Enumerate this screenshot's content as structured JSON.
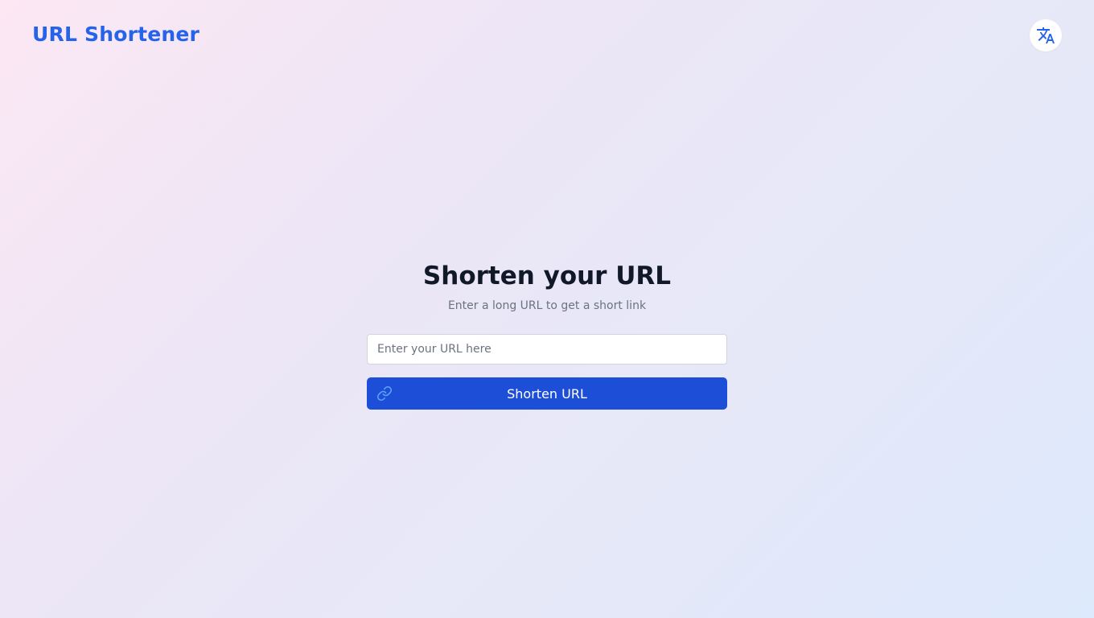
{
  "header": {
    "brand": "URL Shortener",
    "language_icon": "translate-icon"
  },
  "main": {
    "title": "Shorten your URL",
    "subtitle": "Enter a long URL to get a short link",
    "url_input": {
      "value": "",
      "placeholder": "Enter your URL here"
    },
    "shorten_button": {
      "label": "Shorten URL",
      "icon": "link-icon"
    }
  },
  "colors": {
    "brand": "#2563eb",
    "button": "#1d4ed8",
    "title": "#111827",
    "subtitle": "#6b7280"
  }
}
